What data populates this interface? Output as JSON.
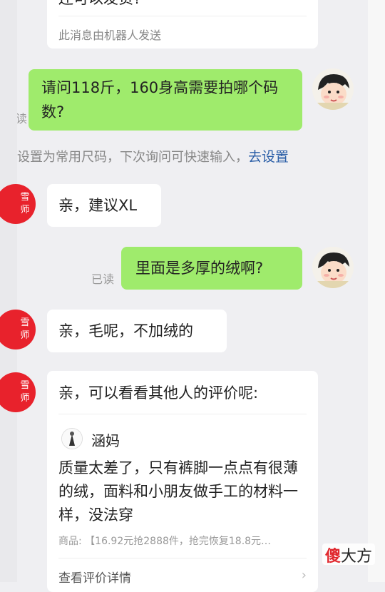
{
  "top_card": {
    "partial_text": "还可以发货?",
    "robot_note": "此消息由机器人发送"
  },
  "messages": [
    {
      "id": "q1",
      "text": "请问118斤，160身高需要拍哪个码数?",
      "read_label": "已读"
    },
    {
      "id": "q2",
      "text": "里面是多厚的绒啊?",
      "read_label": "已读"
    }
  ],
  "system_tip": {
    "text": "设置为常用尺码，下次询问可快速输入，",
    "link": "去设置"
  },
  "replies": [
    {
      "id": "r1",
      "text": "亲，建议XL",
      "avatar_text": "雪师"
    },
    {
      "id": "r2",
      "text": "亲，毛呢，不加绒的",
      "avatar_text": "雪师"
    }
  ],
  "review_card": {
    "avatar_text": "雪师",
    "intro": "亲，可以看看其他人的评价呢:",
    "reviewer_name": "涵妈",
    "review_text": "质量太差了，只有裤脚一点点有很薄的绒，面料和小朋友做手工的材料一样，没法穿",
    "product_label": "商品:",
    "product_value": "【16.92元抢2888件，抢完恢复18.8元…",
    "view_details": "查看评价详情"
  },
  "watermark": {
    "part1": "傻",
    "part2": "大方"
  },
  "colors": {
    "green_bubble": "#9feb6c",
    "red_avatar": "#e8222c",
    "link": "#2a5ea7"
  }
}
